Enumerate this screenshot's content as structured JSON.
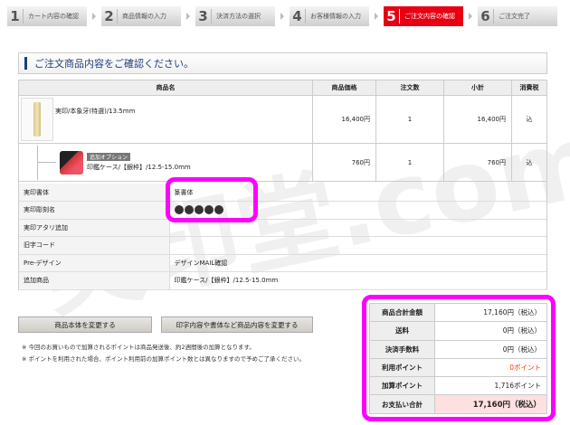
{
  "steps": [
    {
      "num": "1",
      "label": "カート内容の確認",
      "active": false
    },
    {
      "num": "2",
      "label": "商品情報の入力",
      "active": false
    },
    {
      "num": "3",
      "label": "決済方法の選択",
      "active": false
    },
    {
      "num": "4",
      "label": "お客様情報の入力",
      "active": false
    },
    {
      "num": "5",
      "label": "ご注文内容の確認",
      "active": true
    },
    {
      "num": "6",
      "label": "ご注文完了",
      "active": false
    }
  ],
  "heading": "ご注文商品内容をご確認ください。",
  "table": {
    "headers": [
      "商品名",
      "商品価格",
      "注文数",
      "小計",
      "消費税"
    ],
    "rows": [
      {
        "name": "実印/本象牙(特選)/13.5mm",
        "price": "16,400円",
        "qty": "1",
        "subtotal": "16,400円",
        "tax": "込"
      },
      {
        "badge": "追加オプション",
        "name": "印鑑ケース/【銀枠】/12.5-15.0mm",
        "price": "760円",
        "qty": "1",
        "subtotal": "760円",
        "tax": "込"
      }
    ]
  },
  "details": [
    {
      "label": "実印書体",
      "value": "篆書体"
    },
    {
      "label": "実印彫刻名",
      "value": "●●●●●"
    },
    {
      "label": "実印アタリ追加",
      "value": ""
    },
    {
      "label": "旧字コード",
      "value": ""
    },
    {
      "label": "Pre-デザイン",
      "value": "デザインMAIL確認"
    },
    {
      "label": "追加商品",
      "value": "印鑑ケース/【銀枠】/12.5-15.0mm"
    }
  ],
  "buttons": {
    "change_product": "商品本体を変更する",
    "change_content": "印字内容や書体など商品内容を変更する"
  },
  "notes": [
    "※ 今回のお買いもので加算されるポイントは商品発送後、約2週間後の加算となります。",
    "※ ポイントを利用された場合、ポイント利用前の加算ポイント数とは異なりますので予めご了承ください。"
  ],
  "summary": [
    {
      "label": "商品合計金額",
      "value": "17,160円（税込）"
    },
    {
      "label": "送料",
      "value": "0円（税込）"
    },
    {
      "label": "決済手数料",
      "value": "0円（税込）"
    },
    {
      "label": "利用ポイント",
      "value": "0ポイント"
    },
    {
      "label": "加算ポイント",
      "value": "1,716ポイント"
    },
    {
      "label": "お支払い合計",
      "value": "17,160円（税込）"
    }
  ],
  "colors": {
    "active_step": "#e60012",
    "highlight": "#ff00ff",
    "points_used": "#ff3300",
    "total_bg": "#fde0e0",
    "heading": "#1c3f7a"
  },
  "watermark": "実印堂.com"
}
